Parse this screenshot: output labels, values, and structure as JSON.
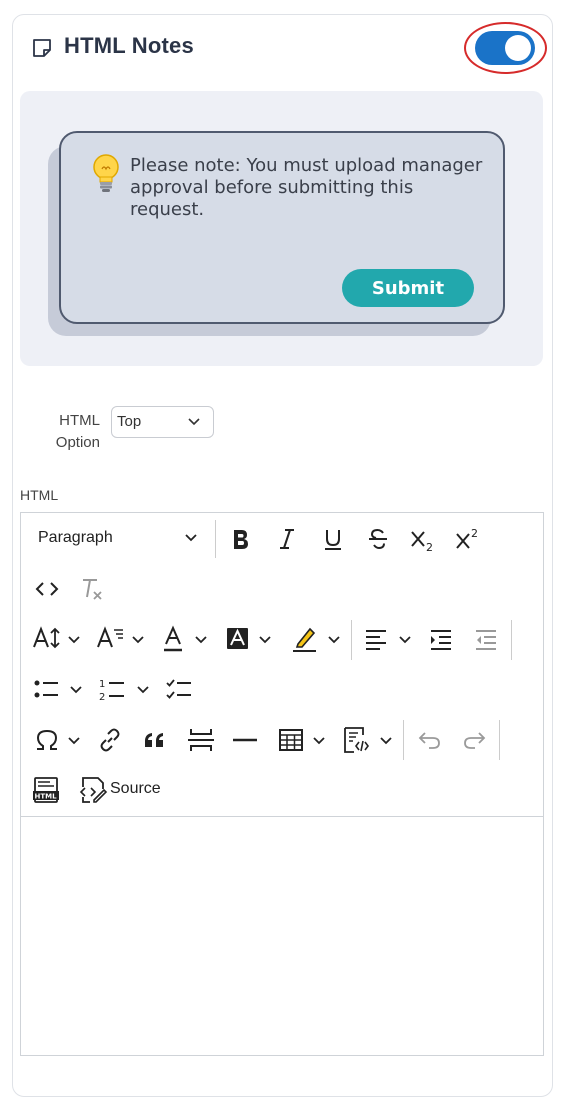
{
  "header": {
    "title": "HTML Notes",
    "toggle_on": true
  },
  "preview": {
    "note_text": "Please note: You must upload manager approval before submitting this request.",
    "submit_label": "Submit"
  },
  "html_option": {
    "label": "HTML Option",
    "selected": "Top"
  },
  "editor": {
    "label": "HTML",
    "block_format": "Paragraph",
    "source_label": "Source",
    "content": ""
  },
  "colors": {
    "toggle_on": "#1a73c8",
    "highlight_ring": "#d62b2b",
    "submit_button": "#22a8ad",
    "note_background": "#d6dce7"
  },
  "icons": [
    "note-icon",
    "lightbulb-icon",
    "chevron-down-icon",
    "bold-icon",
    "italic-icon",
    "underline-icon",
    "strikethrough-icon",
    "subscript-icon",
    "superscript-icon",
    "code-icon",
    "remove-format-icon",
    "font-size-icon",
    "font-family-icon",
    "font-color-icon",
    "font-background-icon",
    "highlight-icon",
    "align-icon",
    "indent-icon",
    "outdent-icon",
    "bulleted-list-icon",
    "numbered-list-icon",
    "todo-list-icon",
    "special-characters-icon",
    "link-icon",
    "blockquote-icon",
    "page-break-icon",
    "horizontal-line-icon",
    "table-icon",
    "html-embed-icon",
    "undo-icon",
    "redo-icon",
    "html-icon",
    "source-icon"
  ]
}
